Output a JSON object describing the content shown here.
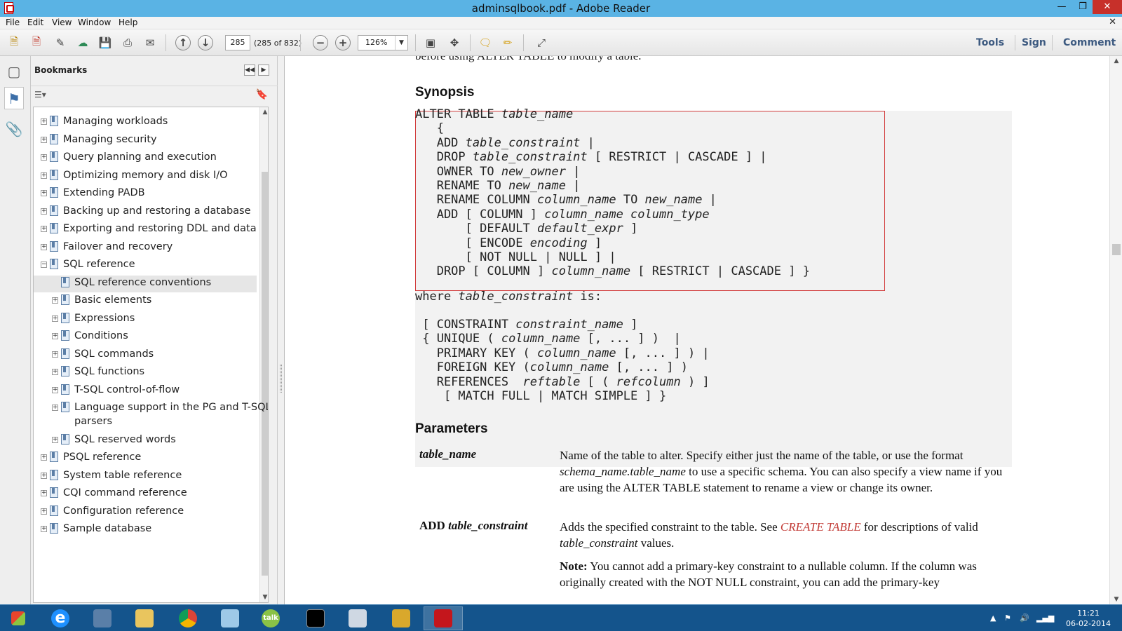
{
  "window": {
    "title": "adminsqlbook.pdf - Adobe Reader"
  },
  "menu": [
    "File",
    "Edit",
    "View",
    "Window",
    "Help"
  ],
  "toolbar": {
    "page_number": "285",
    "page_count": "(285 of 832)",
    "zoom": "126%",
    "tools_label": "Tools",
    "sign_label": "Sign",
    "comment_label": "Comment"
  },
  "bookmarks": {
    "title": "Bookmarks",
    "items": [
      {
        "label": "Managing workloads",
        "level": 0,
        "expander": "+"
      },
      {
        "label": "Managing security",
        "level": 0,
        "expander": "+"
      },
      {
        "label": "Query planning and execution",
        "level": 0,
        "expander": "+"
      },
      {
        "label": "Optimizing memory and disk I/O",
        "level": 0,
        "expander": "+"
      },
      {
        "label": "Extending PADB",
        "level": 0,
        "expander": "+"
      },
      {
        "label": "Backing up and restoring a database",
        "level": 0,
        "expander": "+"
      },
      {
        "label": "Exporting and restoring DDL and data",
        "level": 0,
        "expander": "+"
      },
      {
        "label": "Failover and recovery",
        "level": 0,
        "expander": "+"
      },
      {
        "label": "SQL reference",
        "level": 0,
        "expander": "−"
      },
      {
        "label": "SQL reference conventions",
        "level": 1,
        "expander": "",
        "selected": true
      },
      {
        "label": "Basic elements",
        "level": 1,
        "expander": "+"
      },
      {
        "label": "Expressions",
        "level": 1,
        "expander": "+"
      },
      {
        "label": "Conditions",
        "level": 1,
        "expander": "+"
      },
      {
        "label": "SQL commands",
        "level": 1,
        "expander": "+"
      },
      {
        "label": "SQL functions",
        "level": 1,
        "expander": "+"
      },
      {
        "label": "T-SQL control-of-flow",
        "level": 1,
        "expander": "+"
      },
      {
        "label": "Language support in the PG and T-SQL",
        "label2": "parsers",
        "level": 1,
        "expander": "+"
      },
      {
        "label": "SQL reserved words",
        "level": 1,
        "expander": "+"
      },
      {
        "label": "PSQL reference",
        "level": 0,
        "expander": "+"
      },
      {
        "label": "System table reference",
        "level": 0,
        "expander": "+"
      },
      {
        "label": "CQI command reference",
        "level": 0,
        "expander": "+"
      },
      {
        "label": "Configuration reference",
        "level": 0,
        "expander": "+"
      },
      {
        "label": "Sample database",
        "level": 0,
        "expander": "+"
      }
    ]
  },
  "document": {
    "cut_line": "before using ALTER TABLE to modify a table.",
    "synopsis_heading": "Synopsis",
    "synopsis_lines": [
      "ALTER TABLE <i>table_name</i>",
      "   {",
      "   ADD <i>table_constraint</i> |",
      "   DROP <i>table_constraint</i> [ RESTRICT | CASCADE ] |",
      "   OWNER TO <i>new_owner</i> |",
      "   RENAME TO <i>new_name</i> |",
      "   RENAME COLUMN <i>column_name</i> TO <i>new_name</i> |",
      "   ADD [ COLUMN ] <i>column_name column_type</i>",
      "       [ DEFAULT <i>default_expr</i> ]",
      "       [ ENCODE <i>encoding</i> ]",
      "       [ NOT NULL | NULL ] |",
      "   DROP [ COLUMN ] <i>column_name</i> [ RESTRICT | CASCADE ] }"
    ],
    "where_line": "where <i>table_constraint</i> is:",
    "constraint_lines": [
      " [ CONSTRAINT <i>constraint_name</i> ]",
      " { UNIQUE ( <i>column_name</i> [, ... ] )  |",
      "   PRIMARY KEY ( <i>column_name</i> [, ... ] ) |",
      "   FOREIGN KEY (<i>column_name</i> [, ... ] )",
      "   REFERENCES  <i>reftable</i> [ ( <i>refcolumn</i> ) ]",
      "    [ MATCH FULL | MATCH SIMPLE ] }"
    ],
    "parameters_heading": "Parameters",
    "params": [
      {
        "term": "<i>table_name</i>",
        "desc": "Name of the table to alter. Specify either just the name of the table, or use the format <i>schema_name.table_name</i> to use a specific schema. You can also specify a view name if you are using the ALTER TABLE statement to rename a view or change its owner."
      },
      {
        "term": "ADD <i>table_constraint</i>",
        "desc": "Adds the specified constraint to the table. See <span class=\"xref\">CREATE TABLE</span> for descriptions of valid <i>table_constraint</i> values."
      }
    ],
    "note": "<b>Note:</b>  You cannot add a primary-key constraint to a nullable column. If the column was originally created with the NOT NULL constraint, you can add the primary-key"
  },
  "taskbar": {
    "clock_time": "11:21",
    "clock_date": "06-02-2014"
  }
}
